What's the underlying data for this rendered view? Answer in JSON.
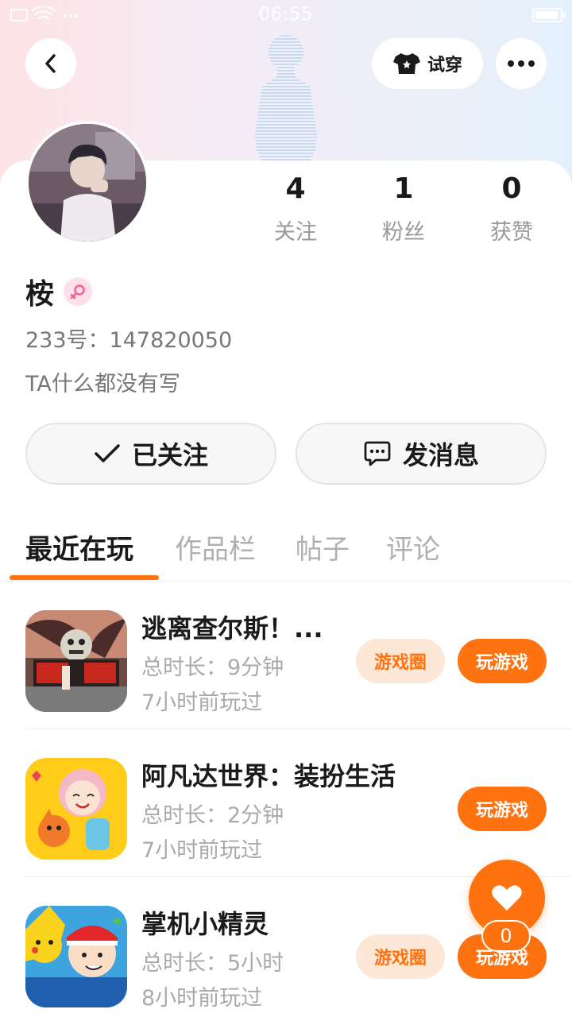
{
  "status_bar": {
    "time": "06:55"
  },
  "header": {
    "try_on_label": "试穿",
    "icons": {
      "back": "back-arrow-icon",
      "try_on": "tshirt-icon",
      "more": "more-dots-icon"
    }
  },
  "profile": {
    "name": "桉",
    "gender": "female",
    "id_label": "233号：",
    "id_value": "147820050",
    "bio": "TA什么都没有写"
  },
  "stats": [
    {
      "value": "4",
      "label": "关注"
    },
    {
      "value": "1",
      "label": "粉丝"
    },
    {
      "value": "0",
      "label": "获赞"
    }
  ],
  "actions": {
    "follow_label": "已关注",
    "message_label": "发消息"
  },
  "tabs": [
    {
      "label": "最近在玩",
      "active": true
    },
    {
      "label": "作品栏",
      "active": false
    },
    {
      "label": "帖子",
      "active": false
    },
    {
      "label": "评论",
      "active": false
    }
  ],
  "games": [
    {
      "title": "逃离查尔斯！...",
      "duration": "总时长：9分钟",
      "last_played": "7小时前玩过",
      "circle_label": "游戏圈",
      "play_label": "玩游戏",
      "has_circle": true
    },
    {
      "title": "阿凡达世界：装扮生活",
      "duration": "总时长：2分钟",
      "last_played": "7小时前玩过",
      "play_label": "玩游戏",
      "has_circle": false
    },
    {
      "title": "掌机小精灵",
      "duration": "总时长：5小时",
      "last_played": "8小时前玩过",
      "circle_label": "游戏圈",
      "play_label": "玩游戏",
      "has_circle": true
    }
  ],
  "like_fab": {
    "count": "0"
  },
  "colors": {
    "accent": "#ff7210",
    "accent_light": "#fde8d8"
  }
}
